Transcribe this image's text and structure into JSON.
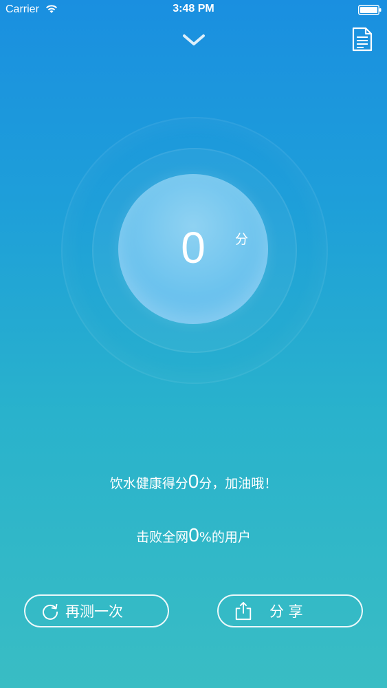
{
  "status_bar": {
    "carrier": "Carrier",
    "time": "3:48 PM"
  },
  "icons": {
    "collapse": "chevron-down-icon",
    "record": "document-icon",
    "retest": "refresh-icon",
    "share": "share-icon"
  },
  "score": {
    "value": "0",
    "unit": "分"
  },
  "messages": {
    "line1_prefix": "饮水健康得分",
    "line1_value": "0",
    "line1_suffix": "分，加油哦！",
    "line2_prefix": "击败全网",
    "line2_value": "0",
    "line2_suffix": "%的用户"
  },
  "buttons": {
    "retest_label": "再测一次",
    "share_label": "分 享"
  },
  "colors": {
    "background_top": "#1a8fe0",
    "background_bottom": "#39bdc4",
    "score_circle": "#6cc3ee",
    "text": "#ffffff"
  }
}
